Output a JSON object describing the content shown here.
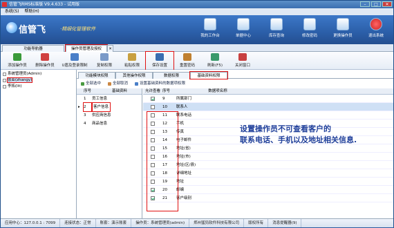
{
  "window": {
    "title": "信管飞RMS标准版 V9.4.633 - 试用版",
    "min": "–",
    "max": "□",
    "close": "✕"
  },
  "menu": [
    "系统(S)",
    "帮助(H)"
  ],
  "brand": {
    "name": "信管飞",
    "slogan": "·精细化管理软件"
  },
  "topnav": [
    {
      "label": "我的工作台",
      "icon": "desktop-icon"
    },
    {
      "label": "单据中心",
      "icon": "documents-icon"
    },
    {
      "label": "库存查询",
      "icon": "inventory-icon"
    },
    {
      "label": "修改密码",
      "icon": "lock-icon"
    },
    {
      "label": "更换操作员",
      "icon": "user-switch-icon"
    },
    {
      "label": "退出系统",
      "icon": "exit-icon"
    }
  ],
  "navtabs": {
    "nav": "功能导航器",
    "current": "操作员管理及授权",
    "close": "✕"
  },
  "toolbar": [
    {
      "label": "添加操作员",
      "icon": "add-user-icon",
      "color": "#3a9a3a"
    },
    {
      "label": "删除操作员",
      "icon": "delete-user-icon",
      "color": "#d04040"
    },
    {
      "label": "U盾及登录限制",
      "icon": "usb-key-icon",
      "color": "#4a7fc8"
    },
    {
      "label": "复制权限",
      "icon": "copy-icon",
      "color": "#7a9ac8"
    },
    {
      "label": "粘贴权限",
      "icon": "paste-icon",
      "color": "#c8a040"
    },
    {
      "label": "保存设置",
      "icon": "save-icon",
      "color": "#3a6eb0"
    },
    {
      "label": "重置密码",
      "icon": "reset-password-icon",
      "color": "#c08030"
    },
    {
      "label": "刷新(F5)",
      "icon": "refresh-icon",
      "color": "#3a9a6a"
    },
    {
      "label": "关闭窗口",
      "icon": "close-window-icon",
      "color": "#c84040"
    }
  ],
  "tree": [
    {
      "label": "系统管理员(Admin)"
    },
    {
      "label": "张亚(zhangy)"
    },
    {
      "label": "李拓(lit)"
    }
  ],
  "subtabs": [
    "功能模块权限",
    "其他操作权限",
    "数据权限",
    "基础资料权限"
  ],
  "subbar": [
    "全部选中",
    "全部取消",
    "设置基础资料的数据项权限"
  ],
  "grid1": {
    "headers": [
      "序号",
      "基础资料"
    ],
    "rows": [
      {
        "no": "1",
        "name": "员工信息"
      },
      {
        "no": "2",
        "name": "客户信息"
      },
      {
        "no": "3",
        "name": "供应商信息"
      },
      {
        "no": "4",
        "name": "商品信息"
      }
    ]
  },
  "grid2": {
    "headers": [
      "允许查看",
      "序号",
      "数据项名称"
    ],
    "rows": [
      {
        "on": true,
        "no": "9",
        "name": "所属部门"
      },
      {
        "on": false,
        "no": "10",
        "name": "联系人"
      },
      {
        "on": false,
        "no": "11",
        "name": "联系电话"
      },
      {
        "on": false,
        "no": "12",
        "name": "手机"
      },
      {
        "on": false,
        "no": "13",
        "name": "传真"
      },
      {
        "on": false,
        "no": "14",
        "name": "电子邮件"
      },
      {
        "on": false,
        "no": "15",
        "name": "地址(省)"
      },
      {
        "on": false,
        "no": "16",
        "name": "地址(市)"
      },
      {
        "on": false,
        "no": "17",
        "name": "地址(区/县)"
      },
      {
        "on": false,
        "no": "18",
        "name": "详细地址"
      },
      {
        "on": false,
        "no": "19",
        "name": "地址"
      },
      {
        "on": true,
        "no": "20",
        "name": "邮编"
      },
      {
        "on": true,
        "no": "21",
        "name": "客户级别"
      }
    ]
  },
  "annotation": {
    "line1": "设置操作员不可查看客户的",
    "line2": "联系电话、手机以及地址相关信息."
  },
  "status": [
    "应用中心：127.0.0.1 : 7099",
    "连接状态：正常",
    "账套：演示账套",
    "操作员：系统管理员(admin)",
    "郑州猛犸软件科技有限公司",
    "版权所有",
    "消息提醒器(9)"
  ]
}
